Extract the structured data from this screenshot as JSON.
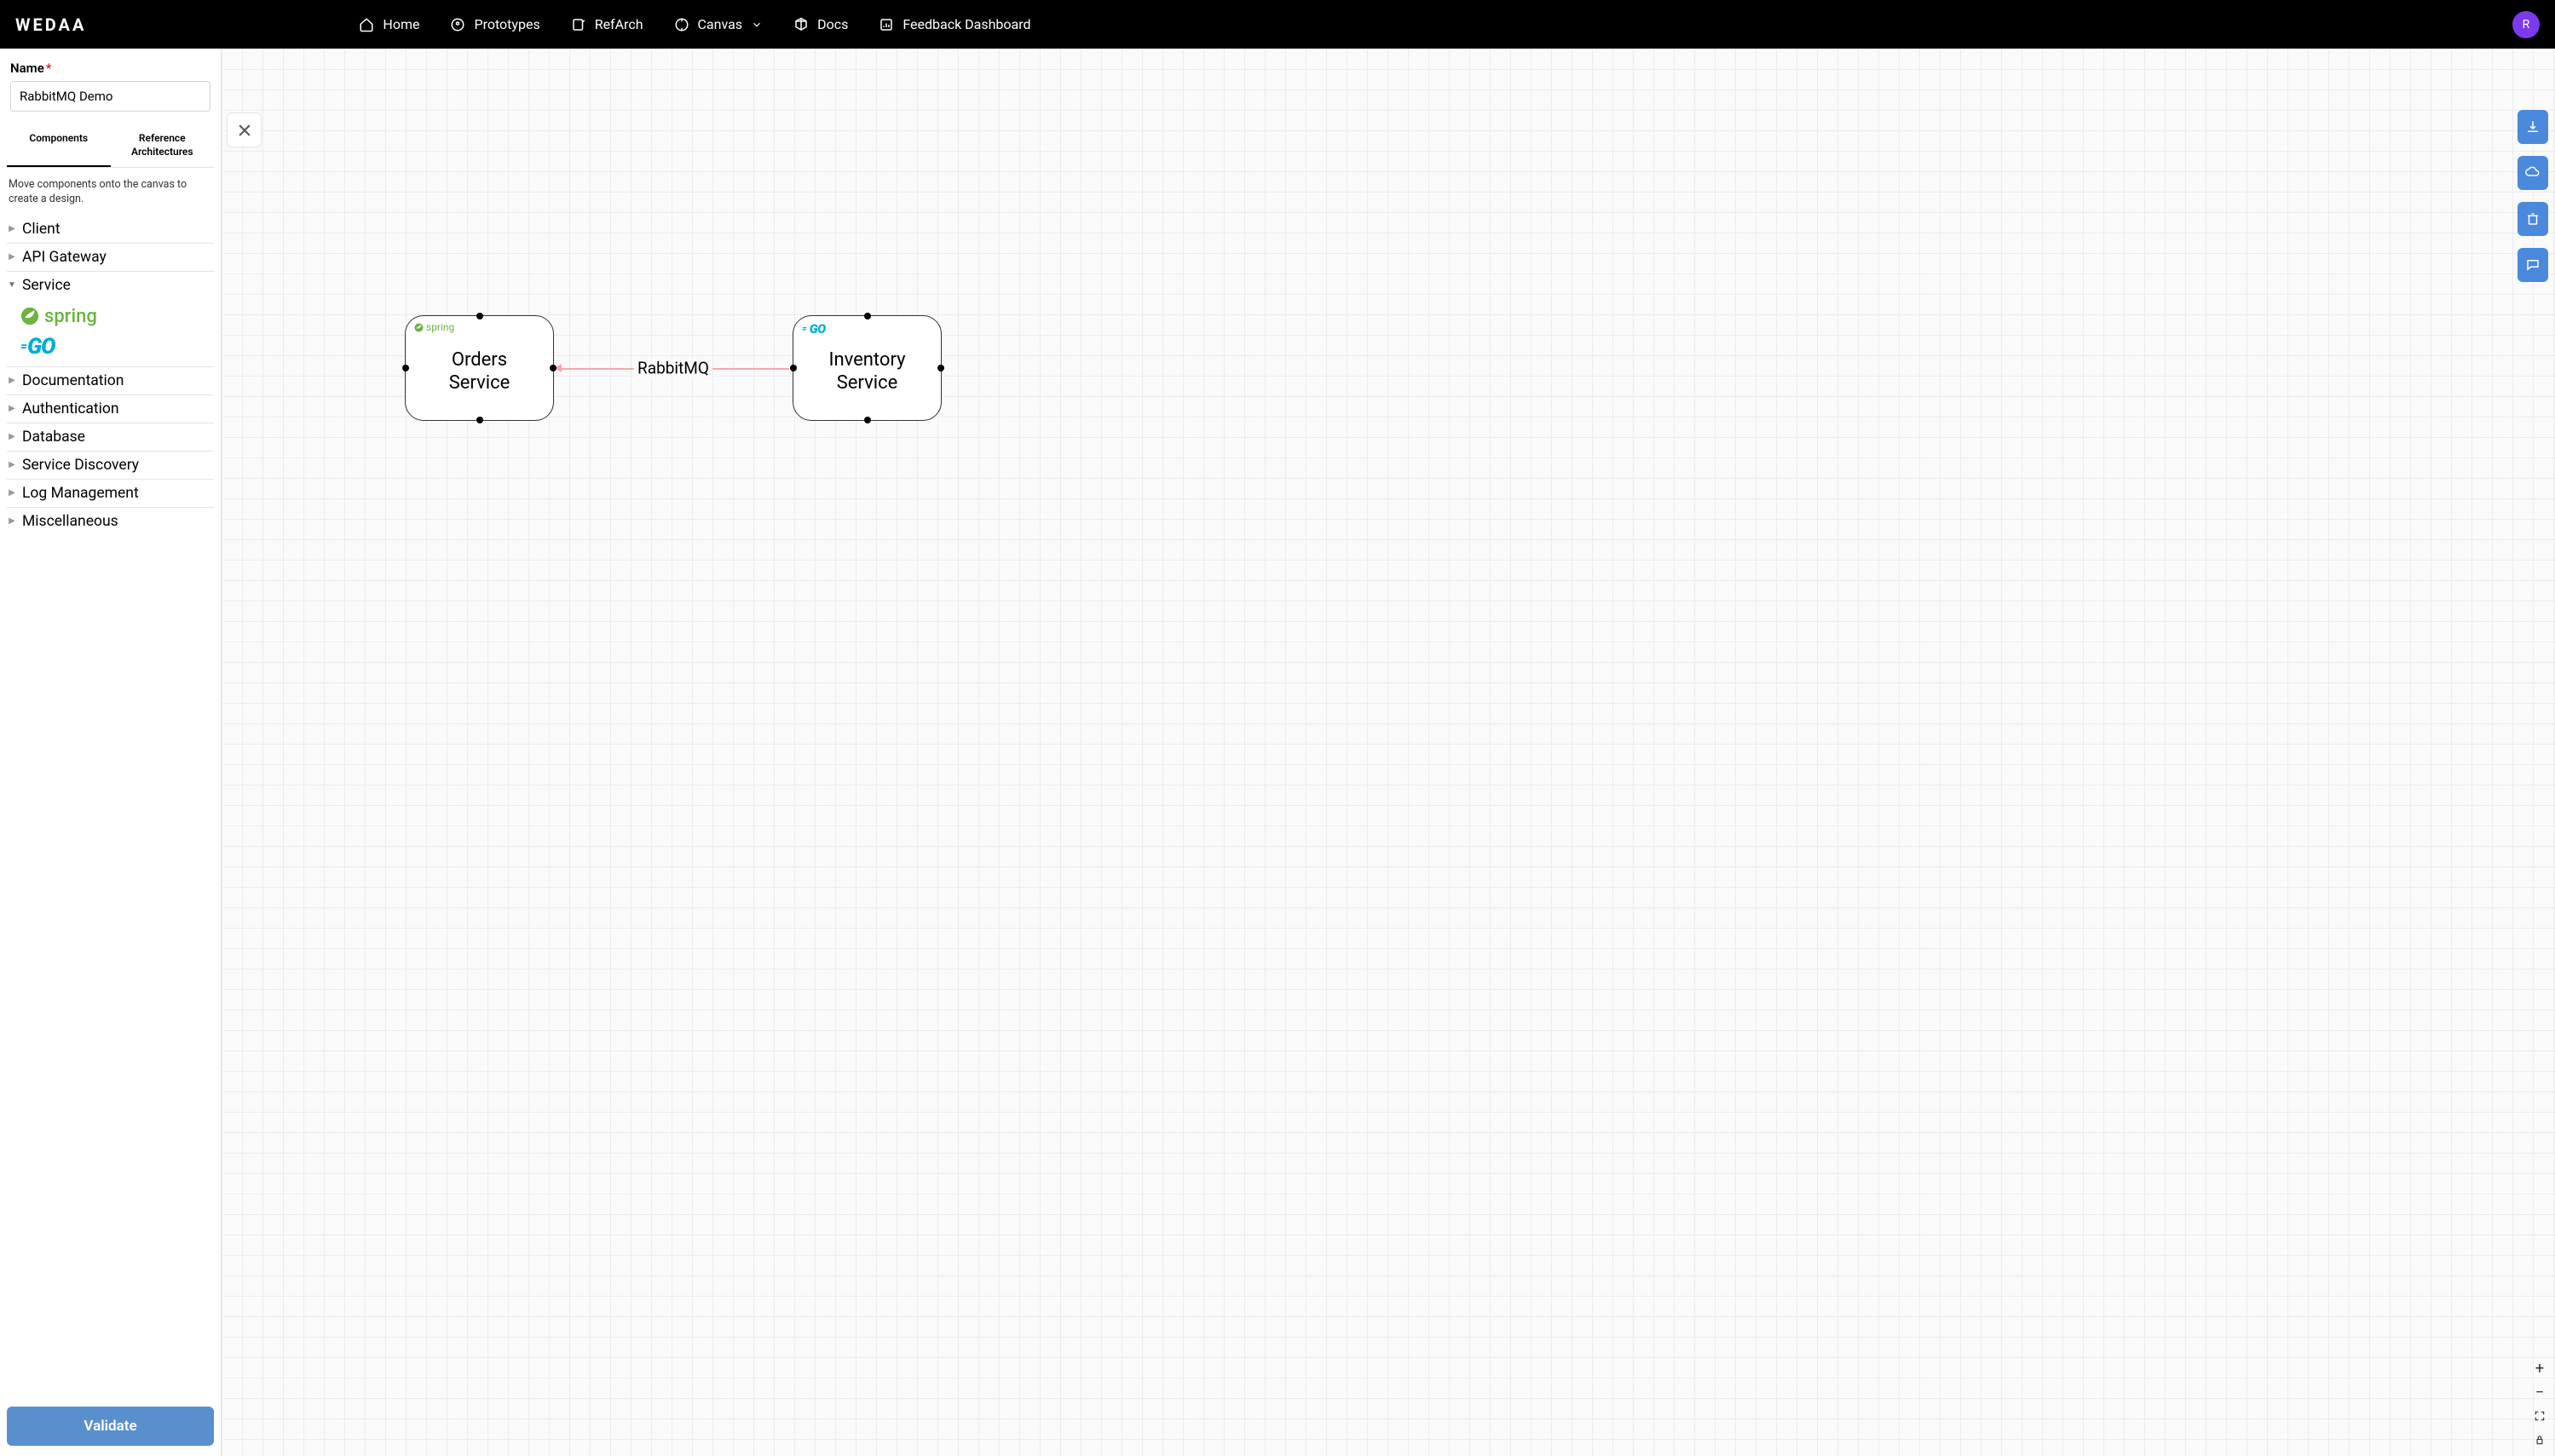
{
  "header": {
    "logo": "WEDAA",
    "nav": {
      "home": "Home",
      "prototypes": "Prototypes",
      "refarch": "RefArch",
      "canvas": "Canvas",
      "docs": "Docs",
      "feedback": "Feedback Dashboard"
    },
    "avatar_initial": "R"
  },
  "sidebar": {
    "name_label": "Name",
    "name_value": "RabbitMQ Demo",
    "tabs": {
      "components": "Components",
      "refarch": "Reference Architectures"
    },
    "hint": "Move components onto the canvas to create a design.",
    "categories": {
      "client": "Client",
      "apigateway": "API Gateway",
      "service": "Service",
      "documentation": "Documentation",
      "authentication": "Authentication",
      "database": "Database",
      "servicediscovery": "Service Discovery",
      "logmanagement": "Log Management",
      "miscellaneous": "Miscellaneous"
    },
    "service_children": {
      "spring": "spring",
      "go": "GO"
    },
    "validate": "Validate"
  },
  "canvas": {
    "node_orders": {
      "label_line1": "Orders",
      "label_line2": "Service",
      "tech": "spring"
    },
    "node_inventory": {
      "label_line1": "Inventory",
      "label_line2": "Service",
      "tech": "GO"
    },
    "edge_label": "RabbitMQ"
  }
}
